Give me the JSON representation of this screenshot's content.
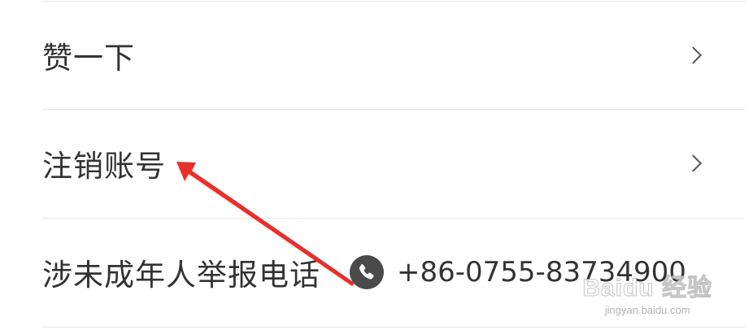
{
  "settings_list": {
    "items": [
      {
        "label": "赞一下",
        "has_chevron": true
      },
      {
        "label": "注销账号",
        "has_chevron": true
      },
      {
        "label": "涉未成年人举报电话",
        "has_chevron": false
      }
    ],
    "report_phone": "+86-0755-83734900"
  },
  "icons": {
    "chevron": "chevron-right-icon",
    "phone": "phone-icon"
  },
  "watermark": {
    "main": "Baidu 经验",
    "sub": "jingyan.baidu.com"
  },
  "annotation": {
    "arrow_color": "#e8302a"
  }
}
